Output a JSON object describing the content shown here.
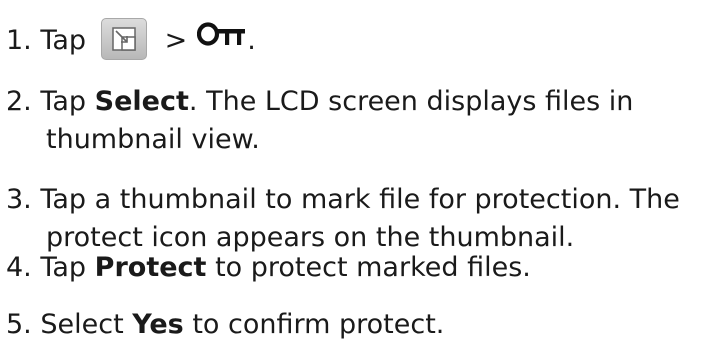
{
  "steps": [
    {
      "number": "1.",
      "text_before": "Tap",
      "separator": ">",
      "text_after": ".",
      "icons": [
        "menu-icon",
        "protect-key-icon"
      ]
    },
    {
      "number": "2.",
      "text_before": "Tap",
      "bold": "Select",
      "text_after": ". The LCD screen displays files in",
      "line2": "thumbnail view."
    },
    {
      "number": "3.",
      "line1": "Tap a thumbnail to mark file for protection. The",
      "line2": "protect icon appears on the thumbnail."
    },
    {
      "number": "4.",
      "text_before": "Tap",
      "bold": "Protect",
      "text_after": "to protect marked files."
    },
    {
      "number": "5.",
      "text_before": "Select",
      "bold": "Yes",
      "text_after": "to confirm protect."
    }
  ]
}
